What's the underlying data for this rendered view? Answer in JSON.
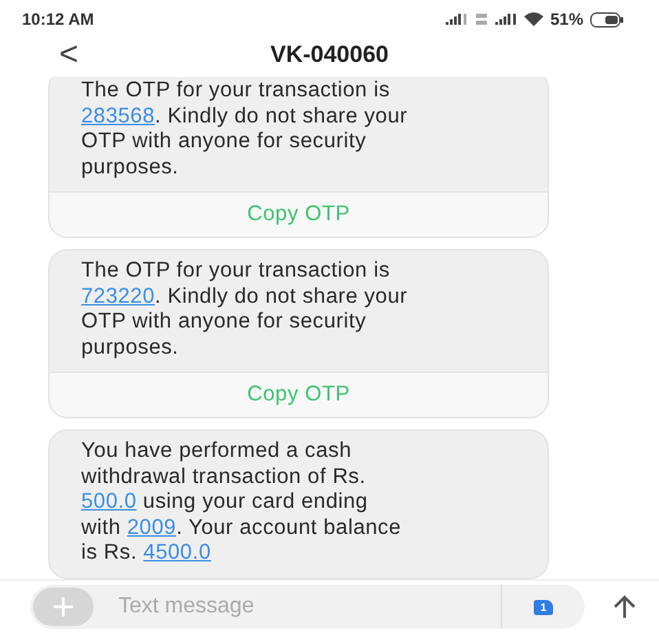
{
  "status_bar": {
    "time": "10:12 AM",
    "battery": "51%"
  },
  "header": {
    "back": "<",
    "title": "VK-040060"
  },
  "messages": [
    {
      "lines": [
        [
          {
            "text": "The OTP for your transaction is"
          }
        ],
        [
          {
            "text": "283568",
            "link": true
          },
          {
            "text": ". Kindly do not share your"
          }
        ],
        [
          {
            "text": "OTP with anyone for security"
          }
        ],
        [
          {
            "text": "purposes."
          }
        ]
      ],
      "action": "Copy OTP"
    },
    {
      "lines": [
        [
          {
            "text": "The OTP for your transaction is"
          }
        ],
        [
          {
            "text": "723220",
            "link": true
          },
          {
            "text": ". Kindly do not share your"
          }
        ],
        [
          {
            "text": "OTP with anyone for security"
          }
        ],
        [
          {
            "text": "purposes."
          }
        ]
      ],
      "action": "Copy OTP"
    },
    {
      "lines": [
        [
          {
            "text": "You have performed a cash"
          }
        ],
        [
          {
            "text": "withdrawal transaction of Rs."
          }
        ],
        [
          {
            "text": "500.0",
            "link": true
          },
          {
            "text": " using your card ending"
          }
        ],
        [
          {
            "text": "with "
          },
          {
            "text": "2009",
            "link": true
          },
          {
            "text": ". Your account balance"
          }
        ],
        [
          {
            "text": "is Rs. "
          },
          {
            "text": "4500.0",
            "link": true
          }
        ]
      ]
    }
  ],
  "compose": {
    "placeholder": "Text message",
    "sim": "1"
  }
}
